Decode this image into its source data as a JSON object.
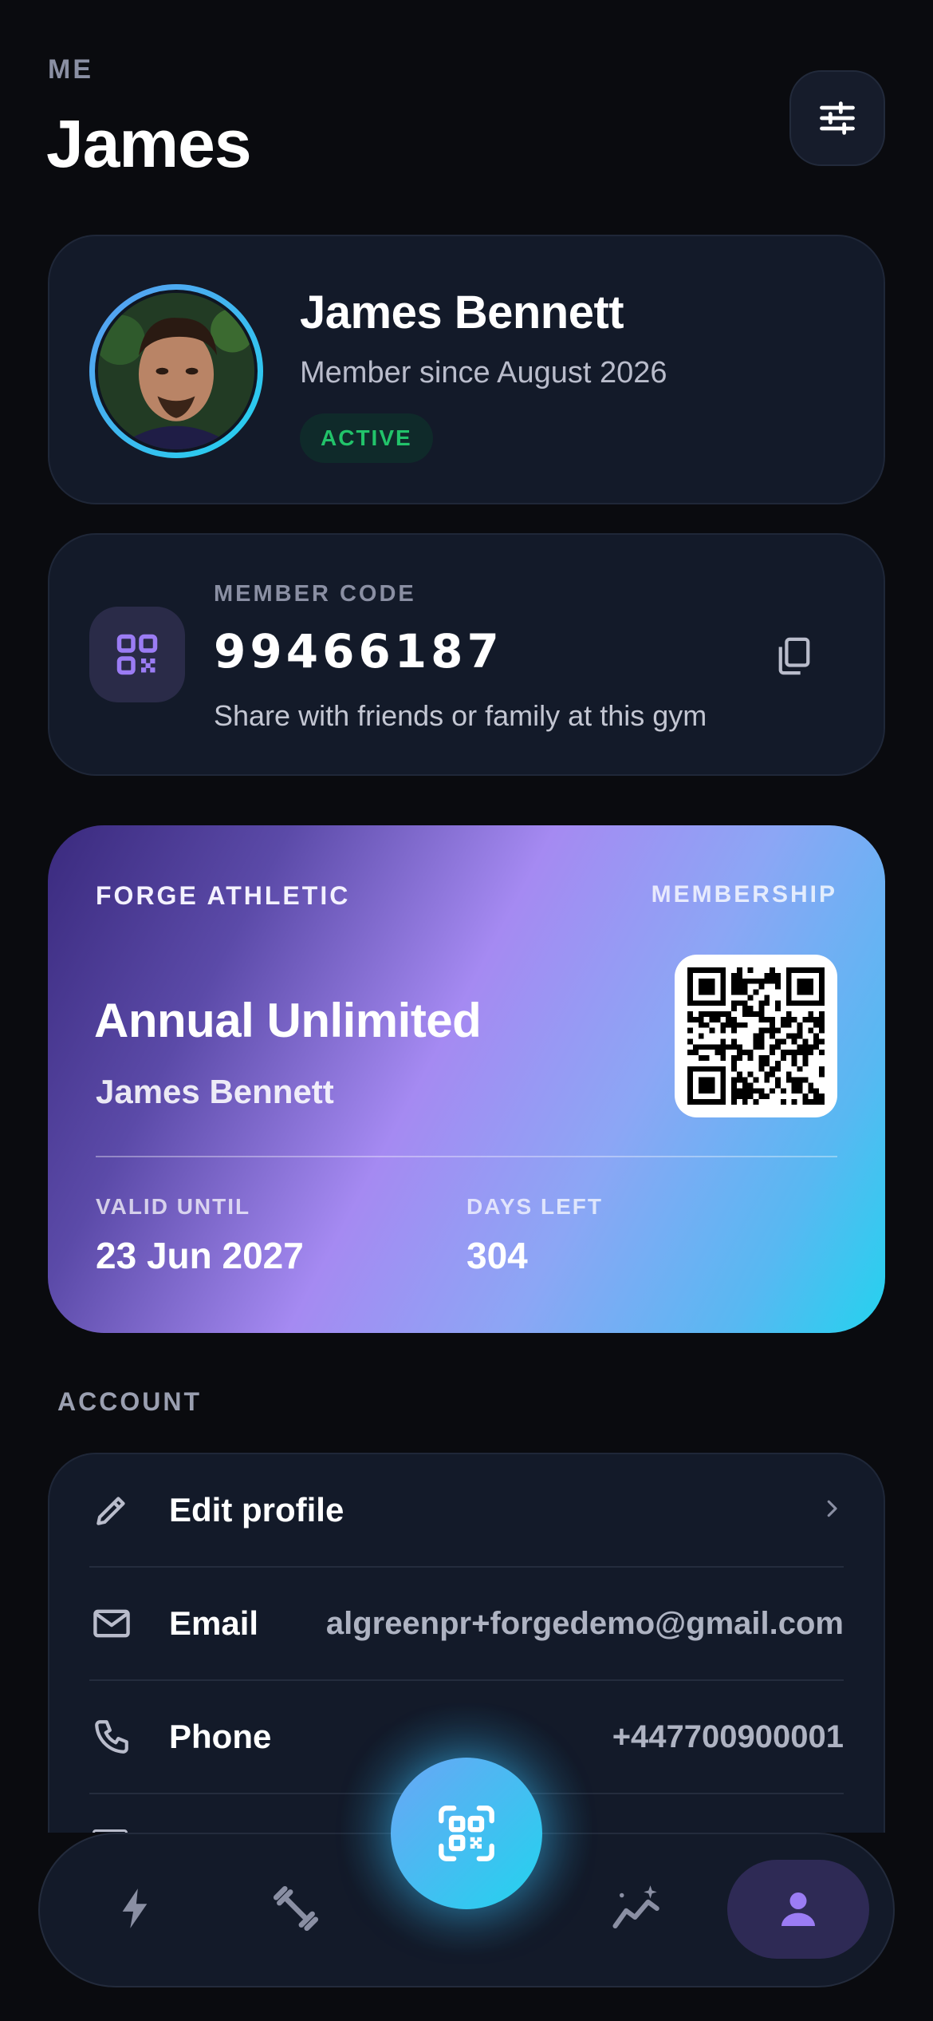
{
  "header": {
    "eyebrow": "ME",
    "title": "James",
    "settings_icon": "sliders-icon"
  },
  "profile": {
    "name": "James Bennett",
    "member_since": "Member since August 2026",
    "status": "ACTIVE",
    "status_color": "#22c36a",
    "ring_colors": [
      "#5b9cf2",
      "#22d3ee"
    ]
  },
  "member_code": {
    "label": "MEMBER CODE",
    "code": "99466187",
    "description": "Share with friends or family at this gym",
    "icon": "qr-code-icon",
    "copy_icon": "copy-icon"
  },
  "membership": {
    "gym": "FORGE ATHLETIC",
    "label": "MEMBERSHIP",
    "plan": "Annual Unlimited",
    "holder": "James Bennett",
    "valid_until_label": "VALID UNTIL",
    "valid_until": "23 Jun 2027",
    "days_left_label": "DAYS LEFT",
    "days_left": "304",
    "gradient": [
      "#3a2a7e",
      "#a58af2",
      "#24d2ee"
    ]
  },
  "account": {
    "title": "ACCOUNT",
    "rows": [
      {
        "label": "Edit profile",
        "value": "",
        "icon": "pencil-icon",
        "trailing": "chevron-right-icon"
      },
      {
        "label": "Email",
        "value": "algreenpr+forgedemo@gmail.com",
        "icon": "mail-icon"
      },
      {
        "label": "Phone",
        "value": "+447700900001",
        "icon": "phone-icon"
      }
    ]
  },
  "nav": {
    "items": [
      {
        "name": "activity",
        "icon": "lightning-icon"
      },
      {
        "name": "workouts",
        "icon": "dumbbell-icon"
      },
      {
        "name": "scan",
        "icon": "qr-scan-icon"
      },
      {
        "name": "progress",
        "icon": "sparkle-chart-icon"
      },
      {
        "name": "profile",
        "icon": "user-icon",
        "active": true
      }
    ],
    "accent": "#22d3ee",
    "active_bg": "#2e2a55"
  }
}
